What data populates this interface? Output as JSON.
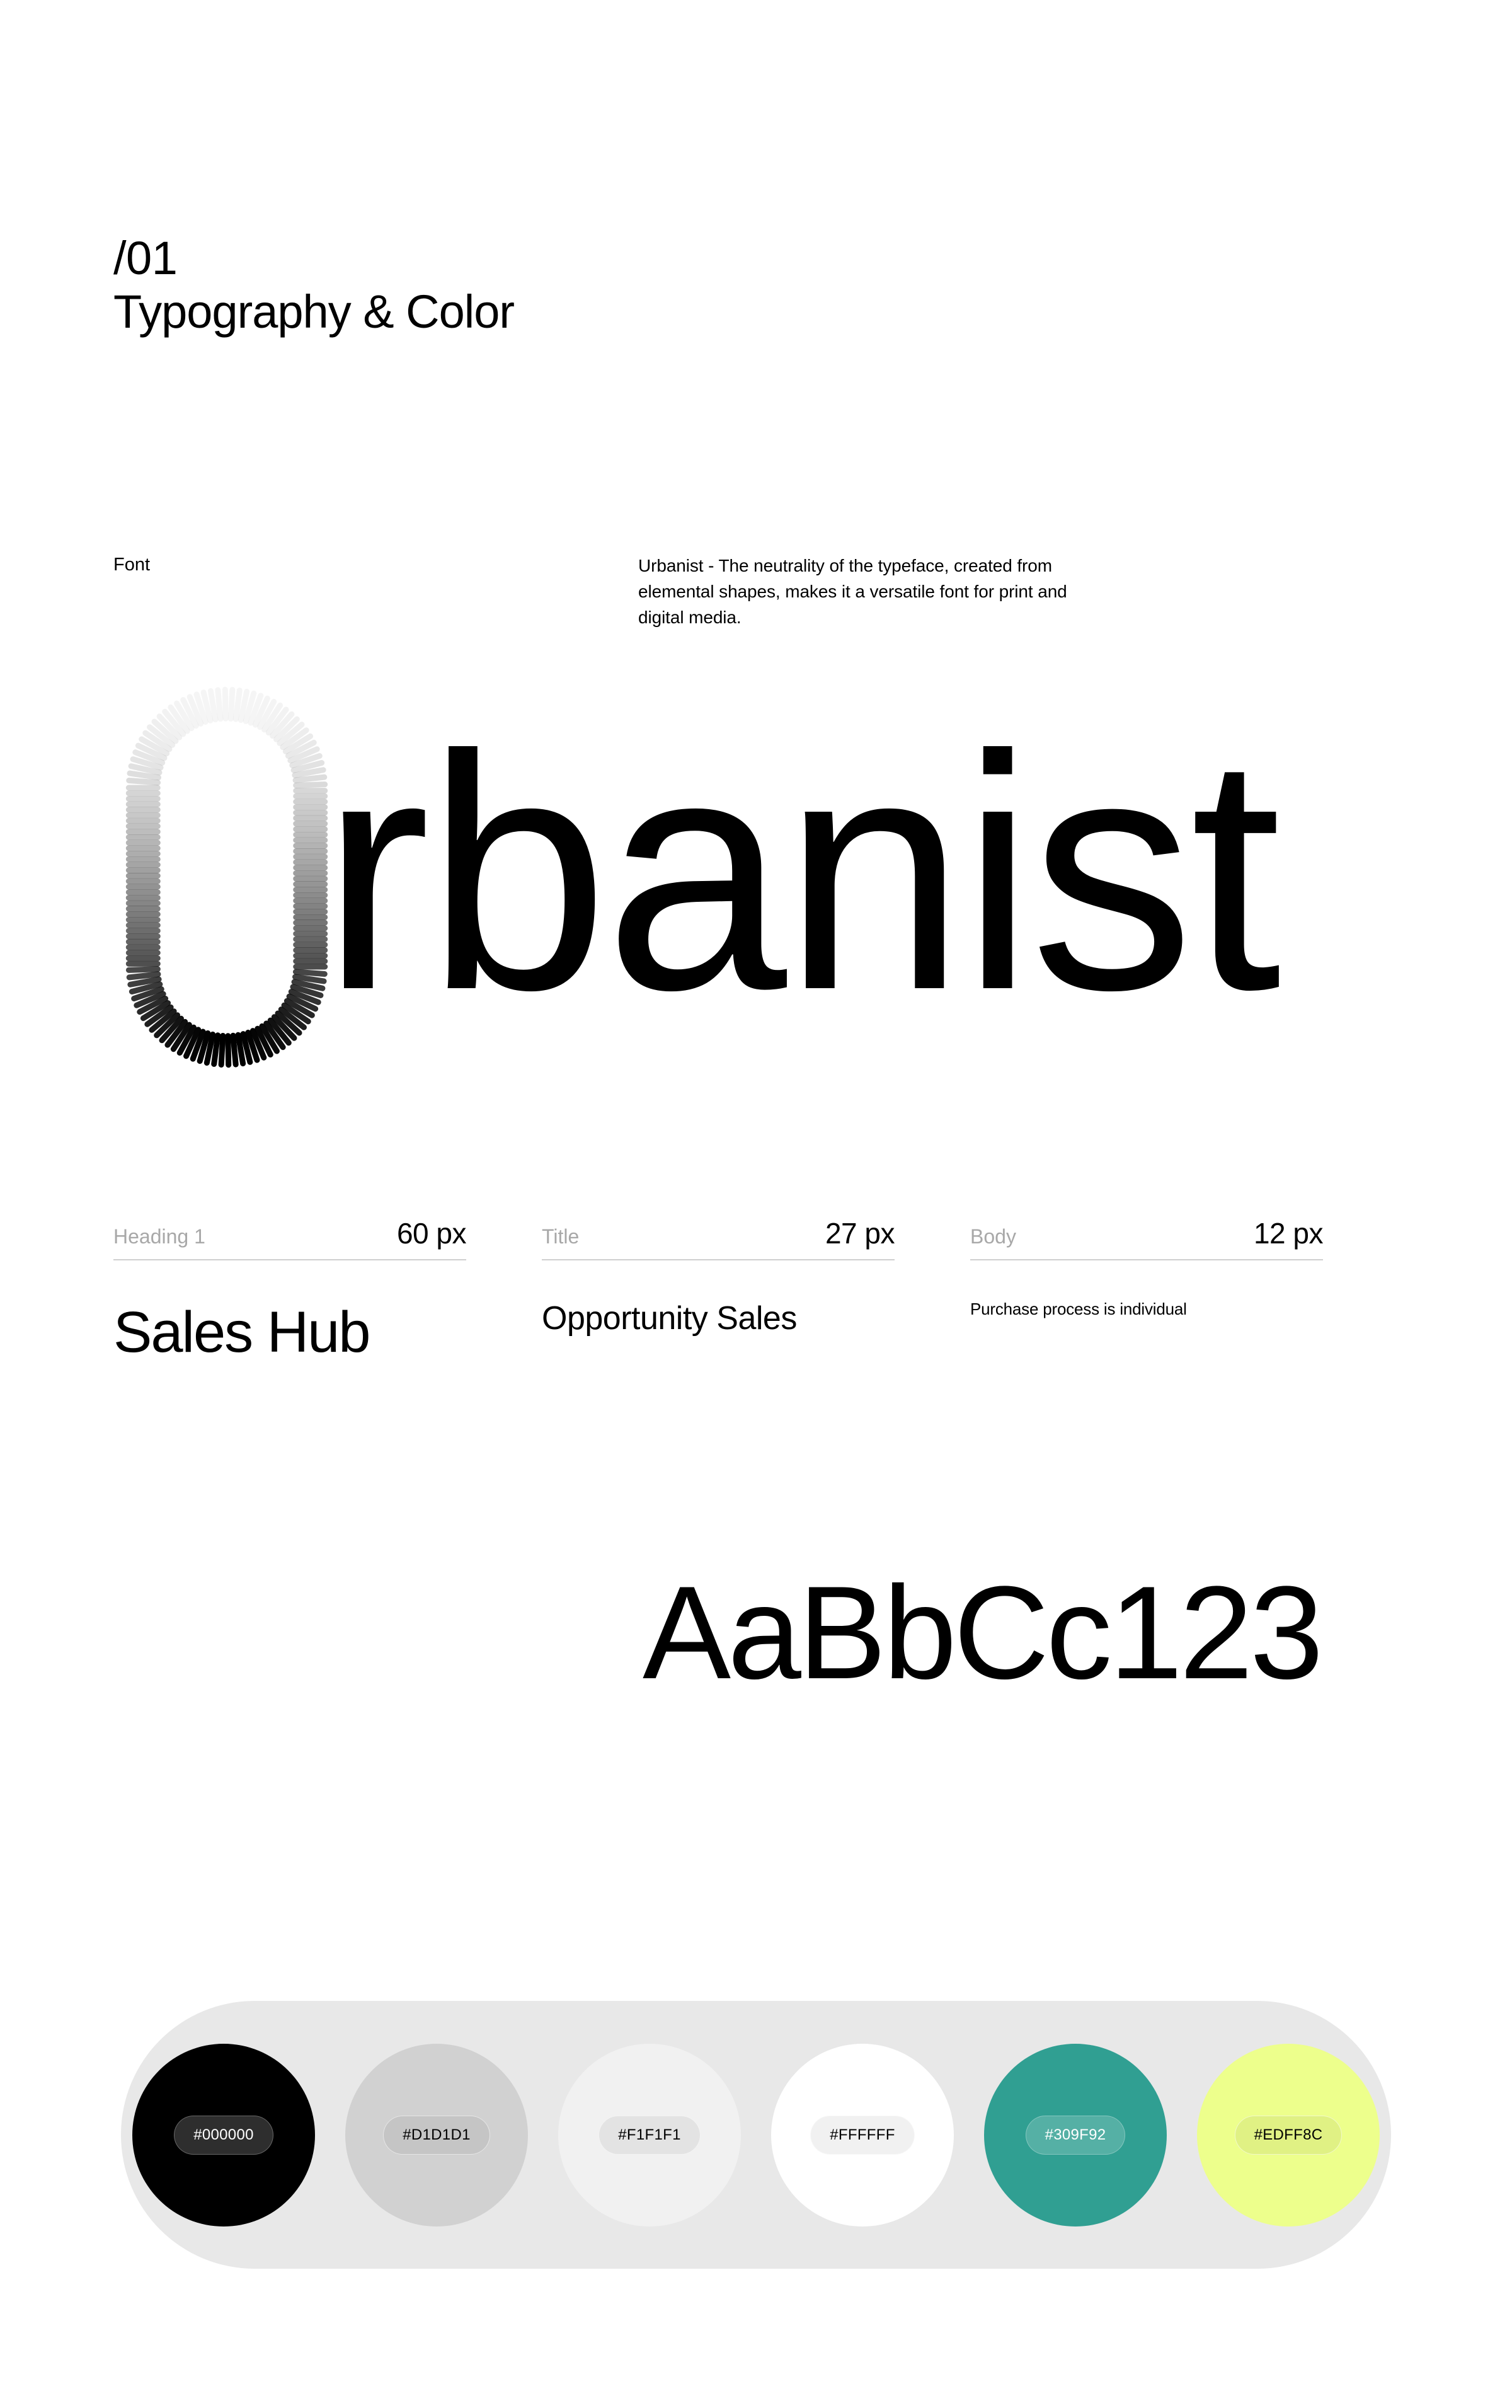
{
  "header": {
    "number": "/01",
    "title": "Typography & Color"
  },
  "font_section": {
    "label": "Font",
    "description": "Urbanist - The neutrality of the typeface, created from elemental shapes, makes it a versatile font for print and digital media.",
    "wordmark_first_letter": "U",
    "wordmark_rest": "rbanist"
  },
  "specimens": [
    {
      "name": "Heading 1",
      "size": "60 px",
      "sample": "Sales Hub"
    },
    {
      "name": "Title",
      "size": "27 px",
      "sample": "Opportunity Sales"
    },
    {
      "name": "Body",
      "size": "12 px",
      "sample": "Purchase process is individual"
    }
  ],
  "glyph_specimen": "AaBbCc123",
  "palette": {
    "container_color": "#E8E8E8",
    "swatches": [
      {
        "hex": "#000000",
        "label": "#000000",
        "text_tone": "dark"
      },
      {
        "hex": "#D1D1D1",
        "label": "#D1D1D1",
        "text_tone": "light"
      },
      {
        "hex": "#F1F1F1",
        "label": "#F1F1F1",
        "text_tone": "light"
      },
      {
        "hex": "#FFFFFF",
        "label": "#FFFFFF",
        "text_tone": "light"
      },
      {
        "hex": "#309F92",
        "label": "#309F92",
        "text_tone": "dark"
      },
      {
        "hex": "#EDFF8C",
        "label": "#EDFF8C",
        "text_tone": "light"
      }
    ]
  }
}
